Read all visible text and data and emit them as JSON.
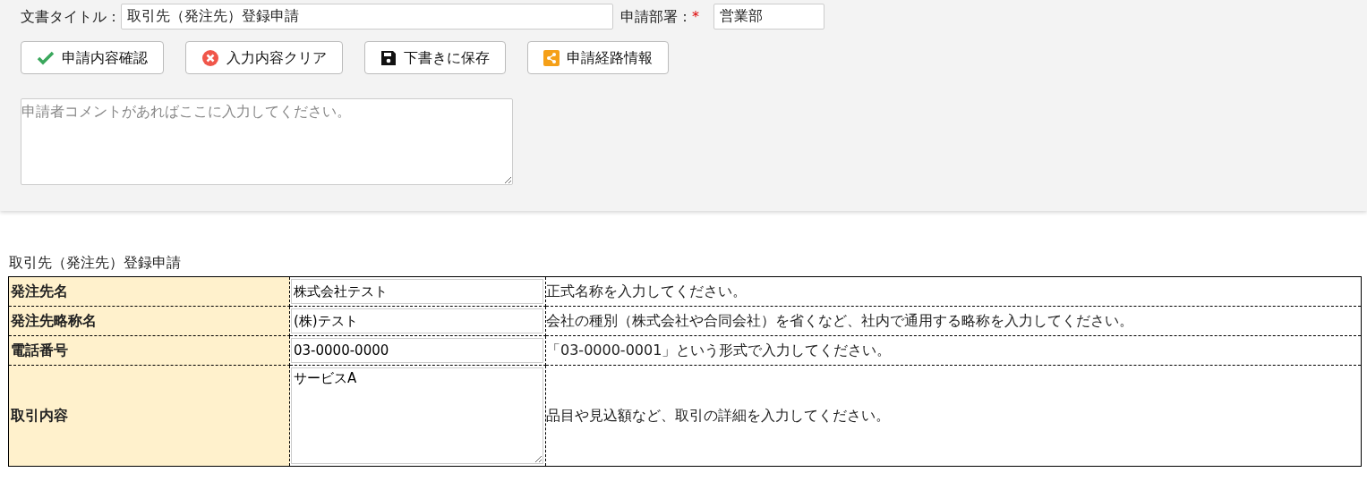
{
  "header": {
    "title_label": "文書タイトル：",
    "title_value": "取引先（発注先）登録申請",
    "department_label": "申請部署：",
    "department_required_mark": "*",
    "department_value": "営業部"
  },
  "buttons": [
    {
      "label": "申請内容確認",
      "kind": "check"
    },
    {
      "label": "入力内容クリア",
      "kind": "clear"
    },
    {
      "label": "下書きに保存",
      "kind": "save"
    },
    {
      "label": "申請経路情報",
      "kind": "share"
    }
  ],
  "comment": {
    "placeholder": "申請者コメントがあればここに入力してください。"
  },
  "form": {
    "caption": "取引先（発注先）登録申請",
    "rows": [
      {
        "label": "発注先名",
        "kind": "input",
        "value": "株式会社テスト",
        "hint": "正式名称を入力してください。"
      },
      {
        "label": "発注先略称名",
        "kind": "input",
        "value": "(株)テスト",
        "hint": "会社の種別（株式会社や合同会社）を省くなど、社内で通用する略称を入力してください。"
      },
      {
        "label": "電話番号",
        "kind": "input",
        "value": "03-0000-0000",
        "hint": "「03-0000-0001」という形式で入力してください。"
      },
      {
        "label": "取引内容",
        "kind": "textarea",
        "value": "サービスA",
        "hint": "品目や見込額など、取引の詳細を入力してください。"
      }
    ]
  }
}
